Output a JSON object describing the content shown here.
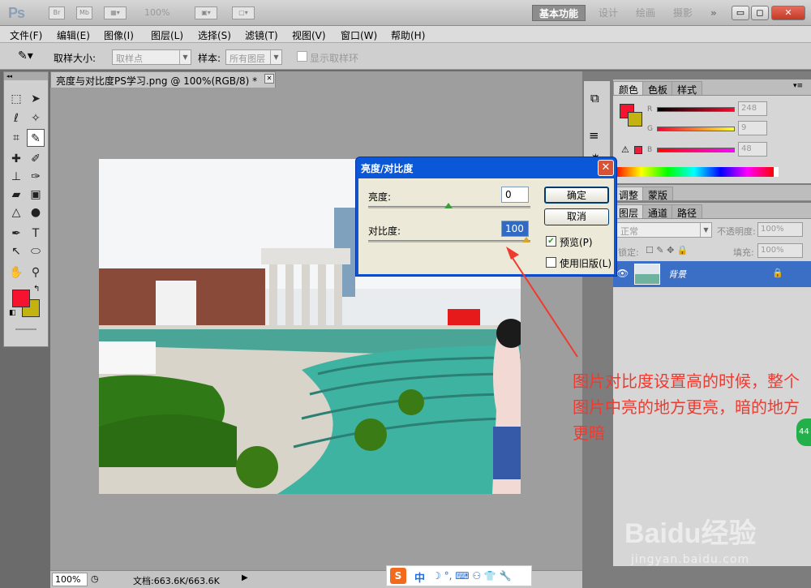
{
  "titlebar": {
    "logo": "Ps",
    "br_icon": "Br",
    "mb_icon": "Mb",
    "zoom": "100%",
    "workspaces": [
      "基本功能",
      "设计",
      "绘画",
      "摄影"
    ],
    "more": "»",
    "win_min": "▭",
    "win_max": "◻",
    "win_close": "✕"
  },
  "menu": [
    "文件(F)",
    "编辑(E)",
    "图像(I)",
    "图层(L)",
    "选择(S)",
    "滤镜(T)",
    "视图(V)",
    "窗口(W)",
    "帮助(H)"
  ],
  "options": {
    "sample_size_label": "取样大小:",
    "sample_size_value": "取样点",
    "sample_label": "样本:",
    "sample_value": "所有图层",
    "show_ring": "显示取样环"
  },
  "document": {
    "tab_title": "亮度与对比度PS学习.png @ 100%(RGB/8) *",
    "close": "✕"
  },
  "statusbar": {
    "zoom": "100%",
    "doc": "文档:663.6K/663.6K"
  },
  "colors": {
    "foreground": "#f5132f",
    "background": "#c2b311"
  },
  "color_panel": {
    "tabs": [
      "颜色",
      "色板",
      "样式"
    ],
    "r_label": "R",
    "r_value": "248",
    "g_label": "G",
    "g_value": "9",
    "b_label": "B",
    "b_value": "48"
  },
  "adjust_panel": {
    "tabs": [
      "调整",
      "蒙版"
    ]
  },
  "layers_panel": {
    "tabs": [
      "图层",
      "通道",
      "路径"
    ],
    "blend_mode": "正常",
    "opacity_label": "不透明度:",
    "opacity_value": "100%",
    "lock_label": "锁定:",
    "fill_label": "填充:",
    "fill_value": "100%",
    "layer_name": "背景"
  },
  "dialog": {
    "title": "亮度/对比度",
    "close": "✕",
    "brightness_label": "亮度:",
    "brightness_value": "0",
    "contrast_label": "对比度:",
    "contrast_value": "100",
    "ok": "确定",
    "cancel": "取消",
    "preview_label": "预览(P)",
    "preview_checked": "✔",
    "legacy_label": "使用旧版(L)"
  },
  "annotation": "图片对比度设置高的时候，整个图片中亮的地方更亮，暗的地方更暗",
  "ime": {
    "logo": "S",
    "lang": "中",
    "icons": "☽ °, ⌨ ⚇ 👕 🔧"
  },
  "watermark": {
    "brand": "Baidu经验",
    "url": "jingyan.baidu.com"
  }
}
